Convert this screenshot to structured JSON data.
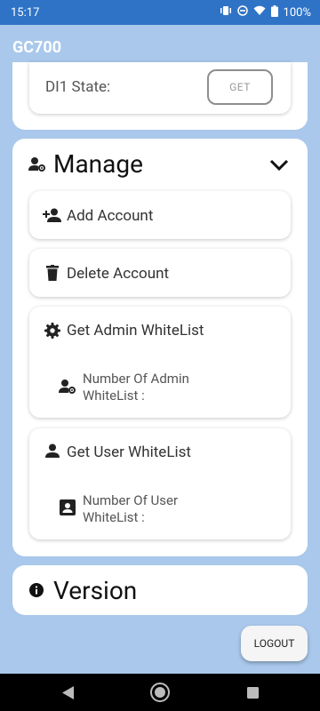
{
  "status": {
    "time": "15:17",
    "battery": "100%"
  },
  "appbar": {
    "title": "GC700"
  },
  "di_card": {
    "label": "DI1 State:",
    "button": "GET"
  },
  "manage": {
    "title": "Manage",
    "add_account": "Add Account",
    "delete_account": "Delete Account",
    "get_admin_whitelist": "Get Admin WhiteList",
    "admin_count_line1": "Number Of Admin",
    "admin_count_line2": "WhiteList :",
    "get_user_whitelist": "Get User WhiteList",
    "user_count_line1": "Number Of User",
    "user_count_line2": "WhiteList :"
  },
  "version": {
    "title": "Version"
  },
  "footer": {
    "logout": "LOGOUT"
  }
}
